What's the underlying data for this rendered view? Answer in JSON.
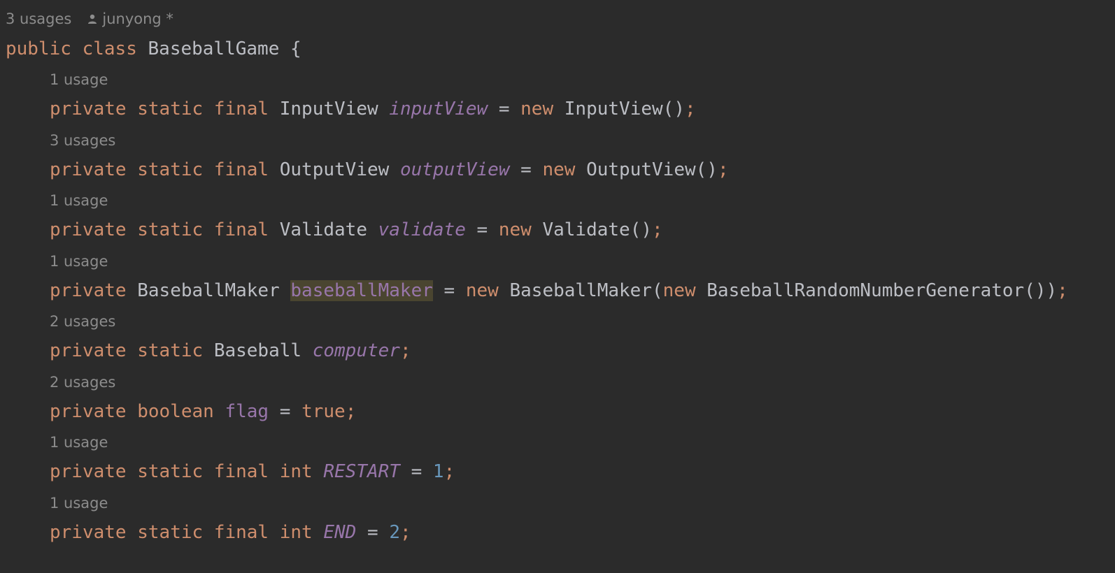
{
  "class_header": {
    "usages": "3 usages",
    "author": "junyong *",
    "kw_public": "public",
    "kw_class": "class",
    "name": "BaseballGame",
    "brace": "{"
  },
  "lines": [
    {
      "usage": "1 usage",
      "p1": "private",
      "p2": "static",
      "p3": "final",
      "type": "InputView",
      "name": "inputView",
      "eq": "=",
      "kw_new": "new",
      "init": "InputView()",
      "semi": ";"
    },
    {
      "usage": "3 usages",
      "p1": "private",
      "p2": "static",
      "p3": "final",
      "type": "OutputView",
      "name": "outputView",
      "eq": "=",
      "kw_new": "new",
      "init": "OutputView()",
      "semi": ";"
    },
    {
      "usage": "1 usage",
      "p1": "private",
      "p2": "static",
      "p3": "final",
      "type": "Validate",
      "name": "validate",
      "eq": "=",
      "kw_new": "new",
      "init": "Validate()",
      "semi": ";"
    },
    {
      "usage": "1 usage",
      "p1": "private",
      "type": "BaseballMaker",
      "name": "baseballMaker",
      "eq": "=",
      "kw_new": "new",
      "init_a": "BaseballMaker(",
      "kw_new2": "new",
      "init_b": "BaseballRandomNumberGenerator())",
      "semi": ";"
    },
    {
      "usage": "2 usages",
      "p1": "private",
      "p2": "static",
      "type": "Baseball",
      "name": "computer",
      "semi": ";"
    },
    {
      "usage": "2 usages",
      "p1": "private",
      "type": "boolean",
      "name": "flag",
      "eq": "=",
      "value": "true",
      "semi": ";"
    },
    {
      "usage": "1 usage",
      "p1": "private",
      "p2": "static",
      "p3": "final",
      "type": "int",
      "name": "RESTART",
      "eq": "=",
      "value": "1",
      "semi": ";"
    },
    {
      "usage": "1 usage",
      "p1": "private",
      "p2": "static",
      "p3": "final",
      "type": "int",
      "name": "END",
      "eq": "=",
      "value": "2",
      "semi": ";"
    }
  ],
  "colors": {
    "background": "#2b2b2b",
    "keyword": "#cf8e6d",
    "field": "#9876aa",
    "number": "#6897bb",
    "text": "#bcbec4",
    "hint": "#8c8c8c",
    "highlight": "#4a4530"
  },
  "icons": {
    "author": "user-icon"
  }
}
